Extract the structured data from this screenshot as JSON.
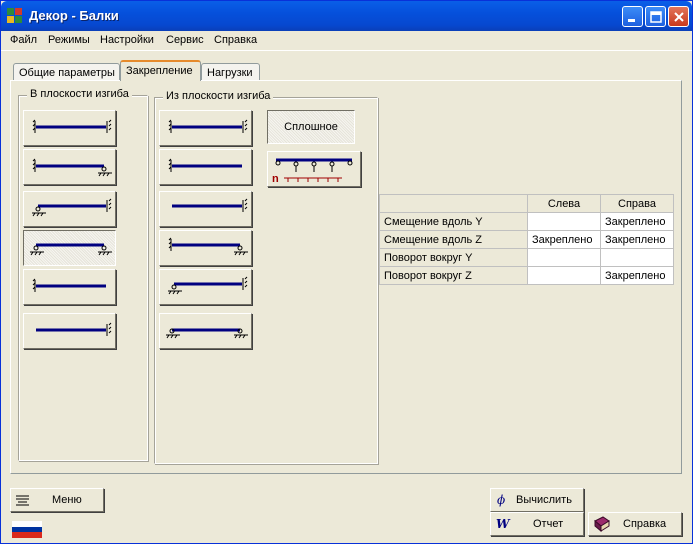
{
  "window": {
    "title": "Декор - Балки"
  },
  "menu": [
    "Файл",
    "Режимы",
    "Настройки",
    "Сервис",
    "Справка"
  ],
  "tabs": [
    {
      "label": "Общие параметры",
      "active": false
    },
    {
      "label": "Закрепление",
      "active": true
    },
    {
      "label": "Нагрузки",
      "active": false
    }
  ],
  "groups": {
    "in_plane": {
      "title": "В плоскости изгиба"
    },
    "out_plane": {
      "title": "Из плоскости изгиба"
    }
  },
  "solid_button": {
    "label": "Сплошное"
  },
  "support_symbol": {
    "label": "n"
  },
  "table": {
    "headers": [
      "",
      "Слева",
      "Справа"
    ],
    "rows": [
      [
        "Смещение вдоль Y",
        "",
        "Закреплено"
      ],
      [
        "Смещение вдоль Z",
        "Закреплено",
        "Закреплено"
      ],
      [
        "Поворот вокруг Y",
        "",
        ""
      ],
      [
        "Поворот вокруг Z",
        "",
        "Закреплено"
      ]
    ]
  },
  "buttons": {
    "menu": {
      "label": "Меню"
    },
    "calculate": {
      "label": "Вычислить"
    },
    "report": {
      "label": "Отчет"
    },
    "help": {
      "label": "Справка"
    }
  },
  "colors": {
    "beam": "#000080",
    "title_bar": "#0550DC",
    "flag": [
      "#FFFFFF",
      "#0033A0",
      "#DA291C"
    ]
  }
}
